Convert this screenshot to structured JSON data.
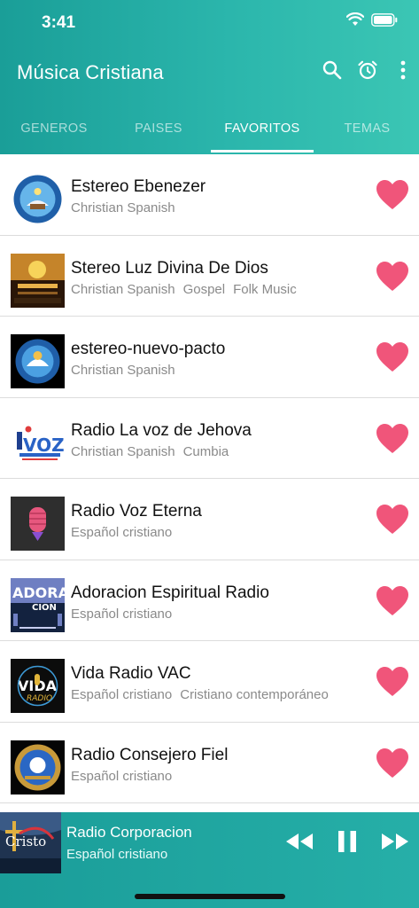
{
  "status_bar": {
    "time": "3:41"
  },
  "app_bar": {
    "title": "Música Cristiana",
    "actions": [
      "search-icon",
      "alarm-icon",
      "more-vertical-icon"
    ]
  },
  "tabs": [
    {
      "label": "GENEROS"
    },
    {
      "label": "PAISES"
    },
    {
      "label": "FAVORITOS",
      "active": true
    },
    {
      "label": "TEMAS"
    }
  ],
  "stations": [
    {
      "title": "Estereo Ebenezer",
      "tags": [
        "Christian Spanish"
      ],
      "favorite": true
    },
    {
      "title": "Stereo Luz Divina De Dios",
      "tags": [
        "Christian Spanish",
        "Gospel",
        "Folk Music"
      ],
      "favorite": true
    },
    {
      "title": "estereo-nuevo-pacto",
      "tags": [
        "Christian Spanish"
      ],
      "favorite": true
    },
    {
      "title": "Radio La voz de Jehova",
      "tags": [
        "Christian Spanish",
        "Cumbia"
      ],
      "favorite": true
    },
    {
      "title": "Radio Voz Eterna",
      "tags": [
        "Español cristiano"
      ],
      "favorite": true
    },
    {
      "title": "Adoracion Espiritual Radio",
      "tags": [
        "Español cristiano"
      ],
      "favorite": true
    },
    {
      "title": "Vida Radio VAC",
      "tags": [
        "Español cristiano",
        "Cristiano contemporáneo"
      ],
      "favorite": true
    },
    {
      "title": "Radio Consejero Fiel",
      "tags": [
        "Español cristiano"
      ],
      "favorite": true
    }
  ],
  "logos": {
    "adora_text": "ADORA",
    "cion_text": "CION",
    "vida_text": "VIDA",
    "radio_text": "RADIO",
    "lavoz_text": "VOZ",
    "cristo_text": "Cristo"
  },
  "player": {
    "title": "Radio Corporacion",
    "subtitle": "Español cristiano",
    "controls": [
      "rewind-icon",
      "pause-icon",
      "fast-forward-icon"
    ]
  },
  "colors": {
    "accent": "#2bb6ac",
    "favorite": "#f0557a"
  }
}
